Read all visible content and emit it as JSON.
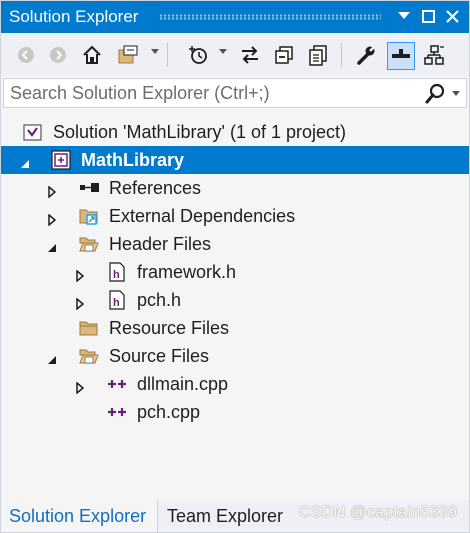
{
  "window": {
    "title": "Solution Explorer"
  },
  "search": {
    "placeholder": "Search Solution Explorer (Ctrl+;)"
  },
  "tree": {
    "solution": "Solution 'MathLibrary' (1 of 1 project)",
    "project": "MathLibrary",
    "references": "References",
    "external": "External Dependencies",
    "header_files": "Header Files",
    "framework_h": "framework.h",
    "pch_h": "pch.h",
    "resource_files": "Resource Files",
    "source_files": "Source Files",
    "dllmain_cpp": "dllmain.cpp",
    "pch_cpp": "pch.cpp"
  },
  "tabs": {
    "solution_explorer": "Solution Explorer",
    "team_explorer": "Team Explorer"
  },
  "watermark": "CSDN @captain5339",
  "colors": {
    "accent": "#007acc",
    "selection": "#007acc",
    "folder": "#dcb67a",
    "header_icon": "#68217a",
    "cpp_icon": "#8e44ad"
  },
  "icons": [
    "back-icon",
    "forward-icon",
    "home-icon",
    "sync-view-icon",
    "pending-changes-icon",
    "switch-views-icon",
    "collapse-all-icon",
    "show-all-files-icon",
    "properties-icon",
    "preview-icon",
    "class-view-icon",
    "search-icon"
  ]
}
